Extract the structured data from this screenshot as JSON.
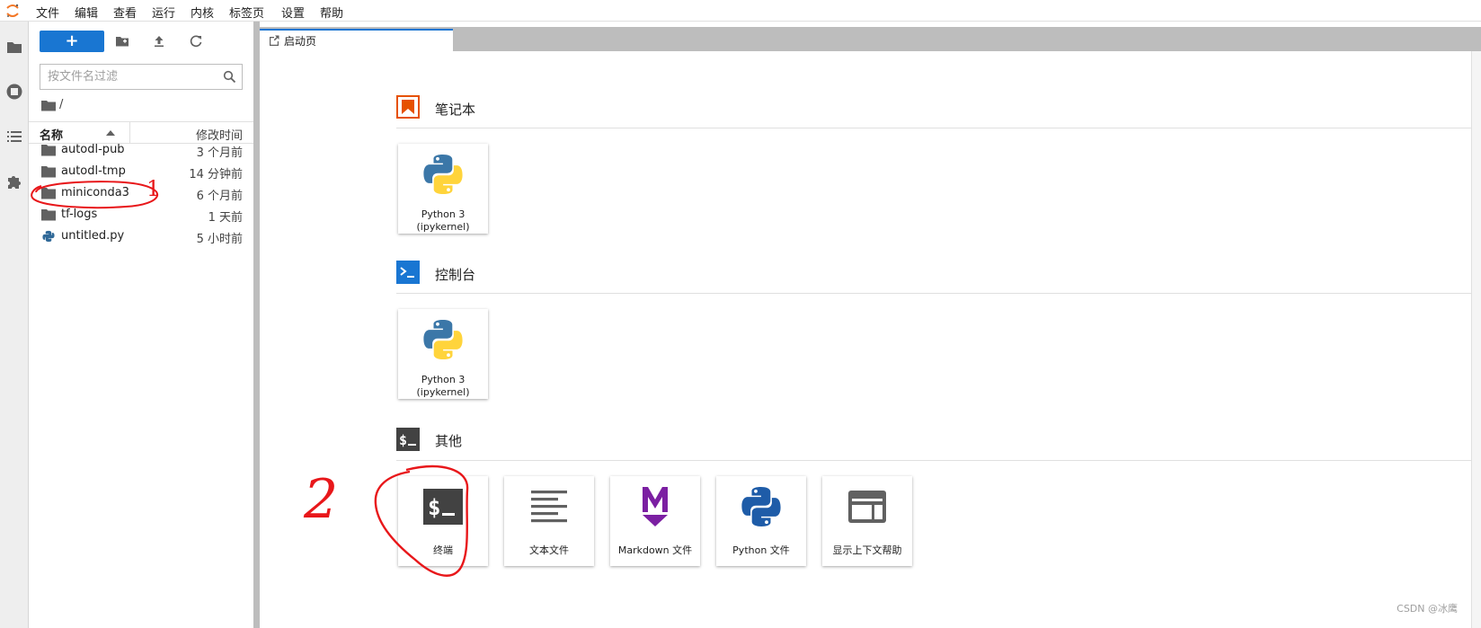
{
  "menubar": {
    "items": [
      "文件",
      "编辑",
      "查看",
      "运行",
      "内核",
      "标签页",
      "设置",
      "帮助"
    ]
  },
  "activity_bar": {
    "icons": [
      "folder-icon",
      "running-icon",
      "toc-icon",
      "extension-icon"
    ]
  },
  "file_browser": {
    "new_button_label": "+",
    "filter_placeholder": "按文件名过滤",
    "breadcrumb": "/",
    "columns": {
      "name": "名称",
      "modified": "修改时间"
    },
    "files": [
      {
        "name": "autodl-pub",
        "modified": "3 个月前",
        "type": "folder"
      },
      {
        "name": "autodl-tmp",
        "modified": "14 分钟前",
        "type": "folder"
      },
      {
        "name": "miniconda3",
        "modified": "6 个月前",
        "type": "folder"
      },
      {
        "name": "tf-logs",
        "modified": "1 天前",
        "type": "folder"
      },
      {
        "name": "untitled.py",
        "modified": "5 小时前",
        "type": "python"
      }
    ]
  },
  "tabs": [
    {
      "label": "启动页",
      "active": true
    }
  ],
  "launcher": {
    "sections": [
      {
        "title": "笔记本",
        "cards": [
          {
            "label_line1": "Python 3",
            "label_line2": "(ipykernel)"
          }
        ]
      },
      {
        "title": "控制台",
        "cards": [
          {
            "label_line1": "Python 3",
            "label_line2": "(ipykernel)"
          }
        ]
      },
      {
        "title": "其他",
        "cards": [
          {
            "label": "终端"
          },
          {
            "label": "文本文件"
          },
          {
            "label": "Markdown 文件"
          },
          {
            "label": "Python 文件"
          },
          {
            "label": "显示上下文帮助"
          }
        ]
      }
    ]
  },
  "annotations": {
    "mark1": "1",
    "mark2": "2"
  },
  "watermark": "CSDN @冰鹰",
  "colors": {
    "accent": "#1976d2",
    "notebook_orange": "#e65100",
    "console_blue": "#1976d2",
    "markdown_purple": "#7b1fa2",
    "annotation_red": "#e8171a"
  }
}
